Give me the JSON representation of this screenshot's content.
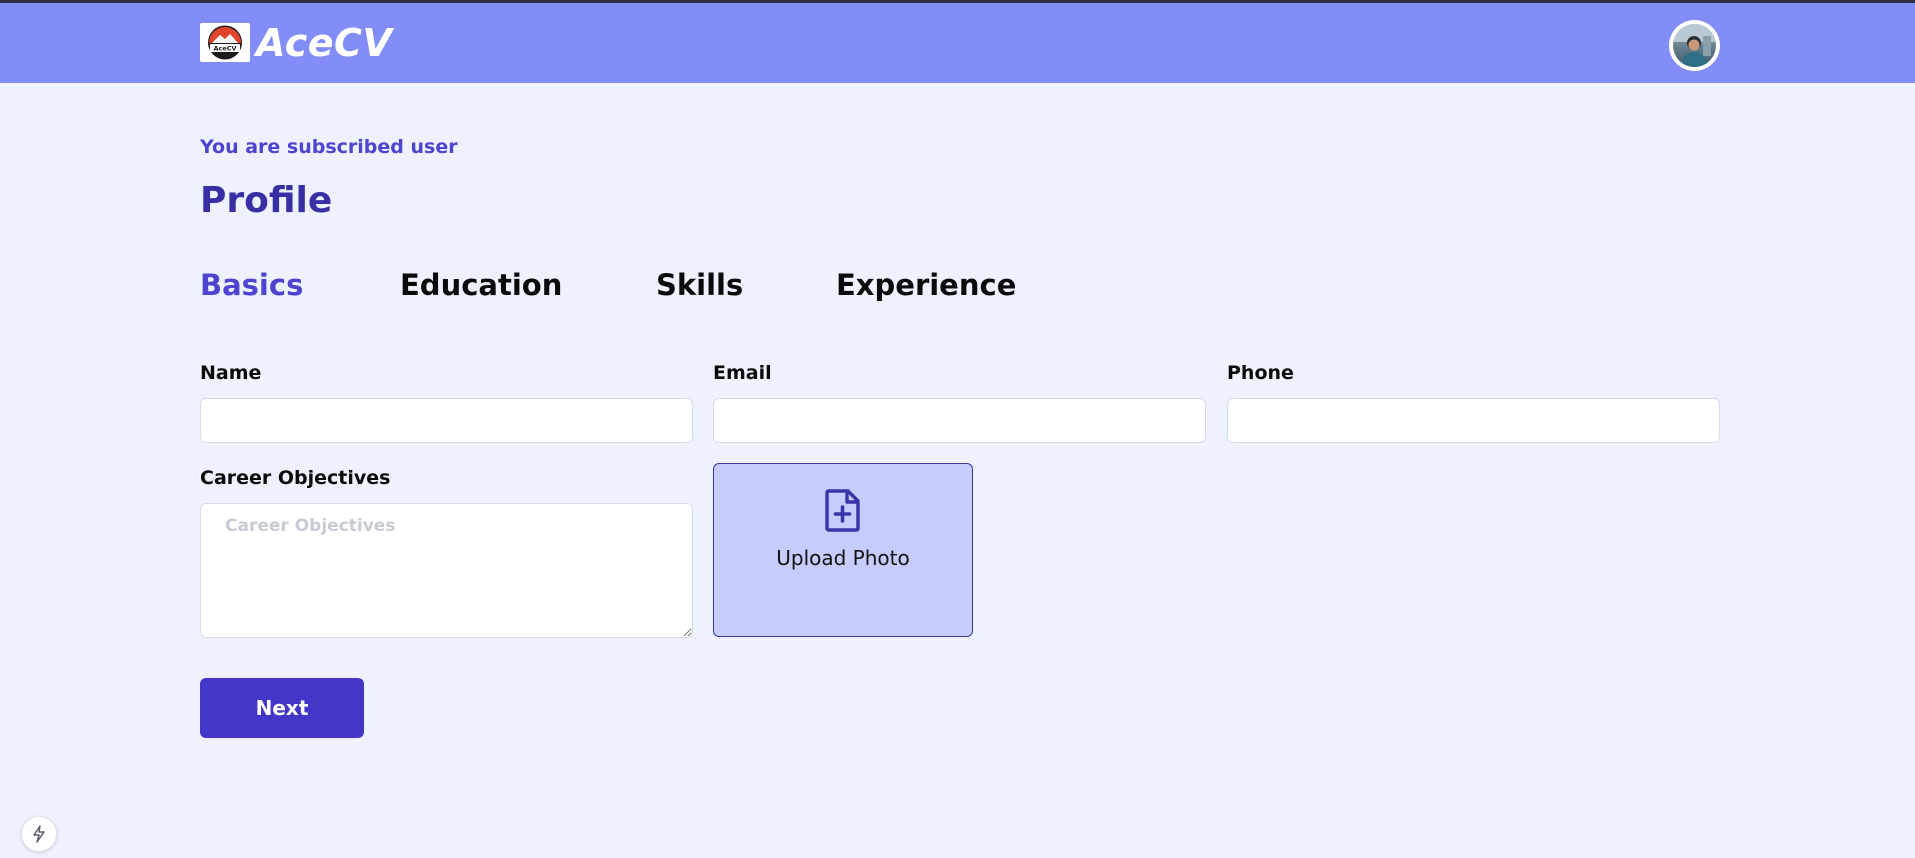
{
  "header": {
    "logo_text": "AceCV",
    "brand": "AceCV"
  },
  "main": {
    "subscription_status": "You are subscribed user",
    "title": "Profile",
    "tabs": [
      {
        "label": "Basics",
        "active": true
      },
      {
        "label": "Education",
        "active": false
      },
      {
        "label": "Skills",
        "active": false
      },
      {
        "label": "Experience",
        "active": false
      }
    ]
  },
  "form": {
    "name_label": "Name",
    "name_value": "",
    "email_label": "Email",
    "email_value": "",
    "phone_label": "Phone",
    "phone_value": "",
    "career_label": "Career Objectives",
    "career_placeholder": "Career Objectives",
    "upload_label": "Upload Photo",
    "next_label": "Next"
  },
  "icons": {
    "upload": "file-plus-icon",
    "devtools": "lightning-icon"
  },
  "colors": {
    "header_bg": "#838df8",
    "page_bg": "#eef2fe",
    "accent": "#4d44d0",
    "title": "#372fa3",
    "button": "#4336c8",
    "upload_bg": "#c6ccfd"
  }
}
